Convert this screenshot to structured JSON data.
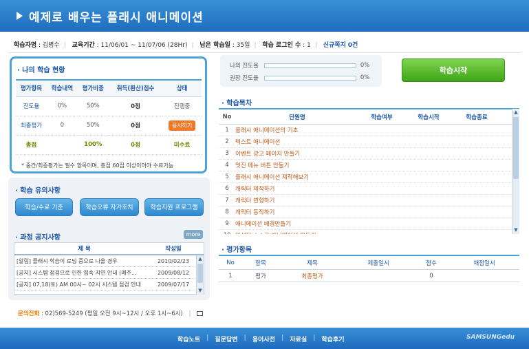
{
  "header": {
    "title": "예제로 배우는 플래시 애니메이션"
  },
  "info": {
    "course_label": "학습자명",
    "course_value": "김병수",
    "period_label": "교육기간",
    "period_value": "11/06/01 ~ 11/07/06 (28Hr)",
    "remain_label": "남은 학습일",
    "remain_value": "35일",
    "login_label": "학습 로그인 수",
    "login_value": "1",
    "msg_label": "신규쪽지",
    "msg_value": "0건"
  },
  "status": {
    "title": "나의 학습 현황",
    "headers": [
      "평가항목",
      "학습내역",
      "평가비중",
      "취득(환산)점수",
      "상태"
    ],
    "rows": [
      {
        "item": "진도율",
        "history": "0%",
        "weight": "50%",
        "score": "0점",
        "state": "진행중"
      },
      {
        "item": "최종평가",
        "history": "0",
        "weight": "50%",
        "score": "0점",
        "state": "응시하기"
      }
    ],
    "total": {
      "item": "총점",
      "history": "",
      "weight": "100%",
      "score": "0점",
      "state": "미수료"
    },
    "note": "* 중간/최종평가는 필수 항목이며, 총점 60점 이상이어야 수료가능"
  },
  "caution": {
    "title": "학습 유의사항",
    "buttons": [
      "학습/수료 기준",
      "학습오류 자가조치",
      "학습지원 프로그램"
    ]
  },
  "notice": {
    "title": "과정 공지사항",
    "more": "more",
    "headers": [
      "제 목",
      "작성일"
    ],
    "rows": [
      {
        "title": "[알림] 플래시 학습이 로딩 중으로 나올 경우",
        "date": "2010/02/23"
      },
      {
        "title": "[공지] 시스템 점검으로 인한 접속 지연 안내 (매주...",
        "date": "2009/08/12"
      },
      {
        "title": "[공지] 07,18(토) AM 00시~ 02시 시스템 점검 안내",
        "date": "2009/07/17"
      }
    ]
  },
  "contact": {
    "label": "문의전화",
    "value": ": 02)569-5249 (평일 오전 9시~12시 / 오후 1시~6시)",
    "sep": "|"
  },
  "progress": {
    "my_label": "나의 진도율",
    "my_value": "0%",
    "my_fraction": 0,
    "rec_label": "권장 진도율",
    "rec_value": "0%",
    "rec_fraction": 0
  },
  "start_button": "학습시작",
  "toc": {
    "title": "학목차",
    "title_full": "학습목차",
    "headers": [
      "No",
      "단원명",
      "학습여부",
      "학습시작",
      "학습종료"
    ],
    "rows": [
      {
        "no": "1",
        "name": "플래시 애니메이션의 기초"
      },
      {
        "no": "2",
        "name": "텍스트 애니메이션"
      },
      {
        "no": "3",
        "name": "이벤트 광고 페이지 만들기"
      },
      {
        "no": "4",
        "name": "멋진 메뉴 버튼 만들기"
      },
      {
        "no": "5",
        "name": "플래시 애니메이션 제작해보기"
      },
      {
        "no": "6",
        "name": "캐릭터 제작하기"
      },
      {
        "no": "7",
        "name": "캐릭터 변형하기"
      },
      {
        "no": "8",
        "name": "캐릭터 동작하기"
      },
      {
        "no": "9",
        "name": "애니메이션 배경만들기"
      },
      {
        "no": "10",
        "name": "완성된 소스로 애니메이션 만들기"
      }
    ]
  },
  "eval": {
    "title": "평가항목",
    "headers": [
      "No",
      "항목",
      "제목",
      "제출일시",
      "점수",
      "채점일시"
    ],
    "rows": [
      {
        "no": "1",
        "item": "평가",
        "name": "최종평가",
        "submitted": "",
        "score": "0",
        "graded": ""
      }
    ]
  },
  "footer": {
    "nav": [
      "학습노트",
      "질문답변",
      "용어사전",
      "자료실",
      "학습후기"
    ],
    "brand": "SAMSUNGedu"
  }
}
